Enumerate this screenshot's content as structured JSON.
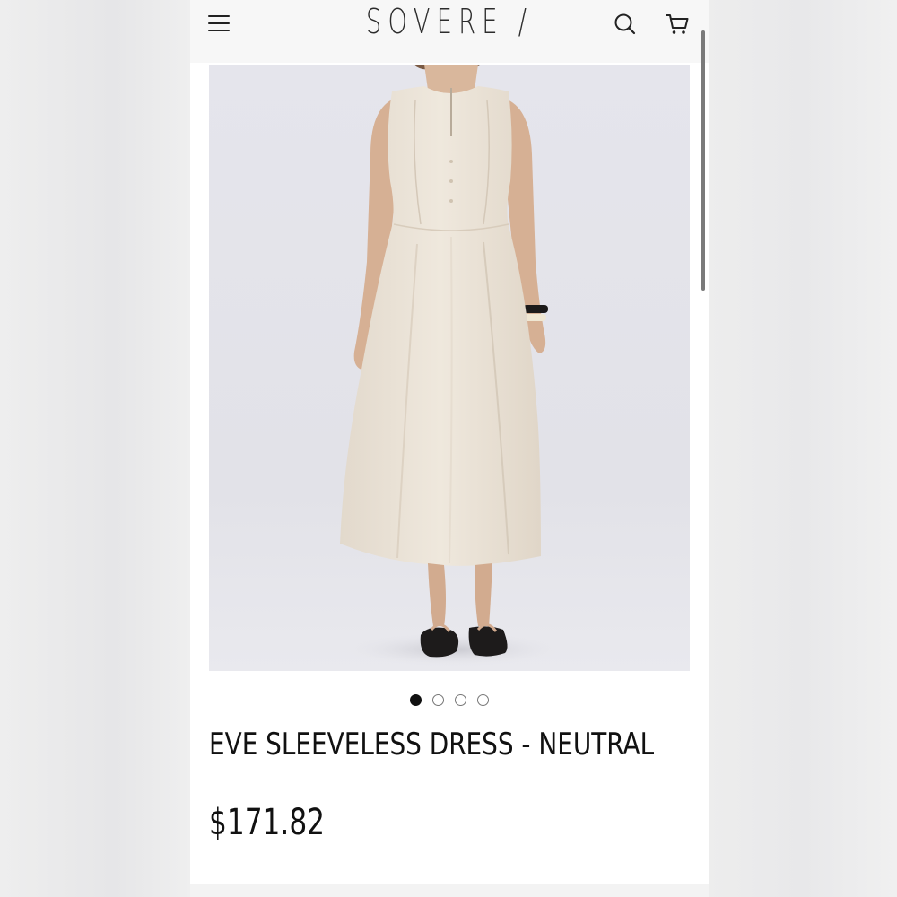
{
  "header": {
    "brand": "SOVERE /",
    "menu_icon": "hamburger-menu-icon",
    "search_icon": "search-icon",
    "cart_icon": "cart-icon"
  },
  "product": {
    "title": "EVE SLEEVELESS DRESS - NEUTRAL",
    "price": "$171.82",
    "image_description_icon": "product-photo",
    "carousel": {
      "count": 4,
      "active_index": 0
    }
  },
  "colors": {
    "header_bg": "#f7f7f7",
    "image_bg": "#e4e4ea",
    "dress": "#ece4d8",
    "text": "#111111"
  }
}
